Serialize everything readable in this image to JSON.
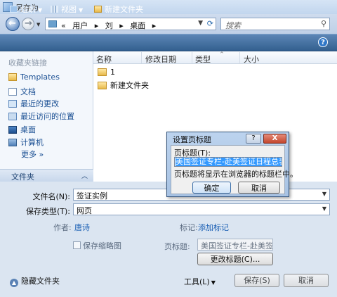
{
  "window": {
    "title": "另存为"
  },
  "nav": {
    "crumbs": [
      "«",
      "用户",
      "▸",
      "刘",
      "▸",
      "桌面",
      "▸"
    ],
    "search_placeholder": "搜索"
  },
  "toolbar": {
    "organize": "组织",
    "views": "视图",
    "new_folder": "新建文件夹",
    "help": "?"
  },
  "sidebar": {
    "header": "收藏夹链接",
    "items": [
      {
        "label": "Templates",
        "icon": "folder-icon"
      },
      {
        "label": "文档",
        "icon": "document-icon"
      },
      {
        "label": "最近的更改",
        "icon": "recent-changes-icon"
      },
      {
        "label": "最近访问的位置",
        "icon": "recent-places-icon"
      },
      {
        "label": "桌面",
        "icon": "desktop-icon"
      },
      {
        "label": "计算机",
        "icon": "computer-icon"
      }
    ],
    "more": "更多  »",
    "folders_label": "文件夹",
    "folders_chevron": "︿"
  },
  "filelist": {
    "columns": [
      "名称",
      "修改日期",
      "类型",
      "大小"
    ],
    "sort_indicator": "^",
    "rows": [
      "1",
      "新建文件夹"
    ]
  },
  "form": {
    "filename_label": "文件名(N):",
    "filename_value": "签证实例",
    "type_label": "保存类型(T):",
    "type_value": "网页",
    "author_label": "作者:",
    "author_value": "唐诗",
    "tags_label": "标记:",
    "tags_value": "添加标记",
    "thumbnail_label": "保存缩略图",
    "page_title_label": "页标题:",
    "page_title_value": "美国签证专栏-赴美签证",
    "change_title_button": "更改标题(C)...",
    "hide_folders": "隐藏文件夹",
    "tools_label": "工具(L)",
    "save_button": "保存(S)",
    "cancel_button": "取消"
  },
  "dialog": {
    "title": "设置页标题",
    "help": "?",
    "close": "X",
    "field_label": "页标题(T):",
    "field_value": "美国签证专栏-赴美签证日程总表实例",
    "note": "页标题将显示在浏览器的标题栏中。",
    "ok": "确定",
    "cancel": "取消"
  },
  "colors": {
    "toolbar": "#3d6a9c",
    "sidebar_link": "#1a4f93",
    "selection": "#3399ff"
  }
}
